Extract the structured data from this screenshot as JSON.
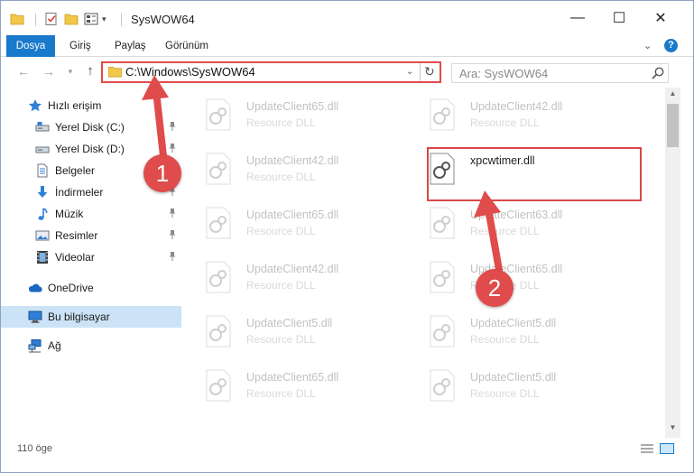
{
  "window": {
    "title": "SysWOW64",
    "minimize_glyph": "—",
    "maximize_glyph": "☐",
    "close_glyph": "✕"
  },
  "ribbon": {
    "tabs": [
      {
        "label": "Dosya",
        "active": true
      },
      {
        "label": "Giriş"
      },
      {
        "label": "Paylaş"
      },
      {
        "label": "Görünüm"
      }
    ],
    "help_glyph": "?"
  },
  "navigation": {
    "address": "C:\\Windows\\SysWOW64",
    "search_placeholder": "Ara: SysWOW64"
  },
  "sidebar": {
    "items": [
      {
        "label": "Hızlı erişim",
        "icon": "star-icon"
      },
      {
        "label": "Yerel Disk (C:)",
        "icon": "drive-icon",
        "pinned": true
      },
      {
        "label": "Yerel Disk (D:)",
        "icon": "drive-icon",
        "pinned": true
      },
      {
        "label": "Belgeler",
        "icon": "documents-icon",
        "pinned": true
      },
      {
        "label": "İndirmeler",
        "icon": "download-icon",
        "pinned": true
      },
      {
        "label": "Müzik",
        "icon": "music-icon",
        "pinned": true
      },
      {
        "label": "Resimler",
        "icon": "pictures-icon",
        "pinned": true
      },
      {
        "label": "Videolar",
        "icon": "videos-icon",
        "pinned": true
      },
      {
        "label": "OneDrive",
        "icon": "cloud-icon"
      },
      {
        "label": "Bu bilgisayar",
        "icon": "computer-icon",
        "selected": true
      },
      {
        "label": "Ağ",
        "icon": "network-icon"
      }
    ]
  },
  "files": [
    {
      "name": "UpdateClient65.dll",
      "type": "Resource DLL",
      "faded": true
    },
    {
      "name": "UpdateClient42.dll",
      "type": "Resource DLL",
      "faded": true
    },
    {
      "name": "UpdateClient42.dll",
      "type": "Resource DLL",
      "faded": true
    },
    {
      "name": "xpcwtimer.dll",
      "type": "",
      "faded": false,
      "highlighted": true
    },
    {
      "name": "UpdateClient65.dll",
      "type": "Resource DLL",
      "faded": true
    },
    {
      "name": "UpdateClient63.dll",
      "type": "Resource DLL",
      "faded": true
    },
    {
      "name": "UpdateClient42.dll",
      "type": "Resource DLL",
      "faded": true
    },
    {
      "name": "UpdateClient65.dll",
      "type": "Resource DLL",
      "faded": true
    },
    {
      "name": "UpdateClient5.dll",
      "type": "Resource DLL",
      "faded": true
    },
    {
      "name": "UpdateClient5.dll",
      "type": "Resource DLL",
      "faded": true
    },
    {
      "name": "UpdateClient65.dll",
      "type": "Resource DLL",
      "faded": true
    },
    {
      "name": "UpdateClient5.dll",
      "type": "Resource DLL",
      "faded": true
    }
  ],
  "status": {
    "item_count": "110 öge"
  },
  "annotations": {
    "step1": "1",
    "step2": "2",
    "color": "#e04b4b"
  }
}
